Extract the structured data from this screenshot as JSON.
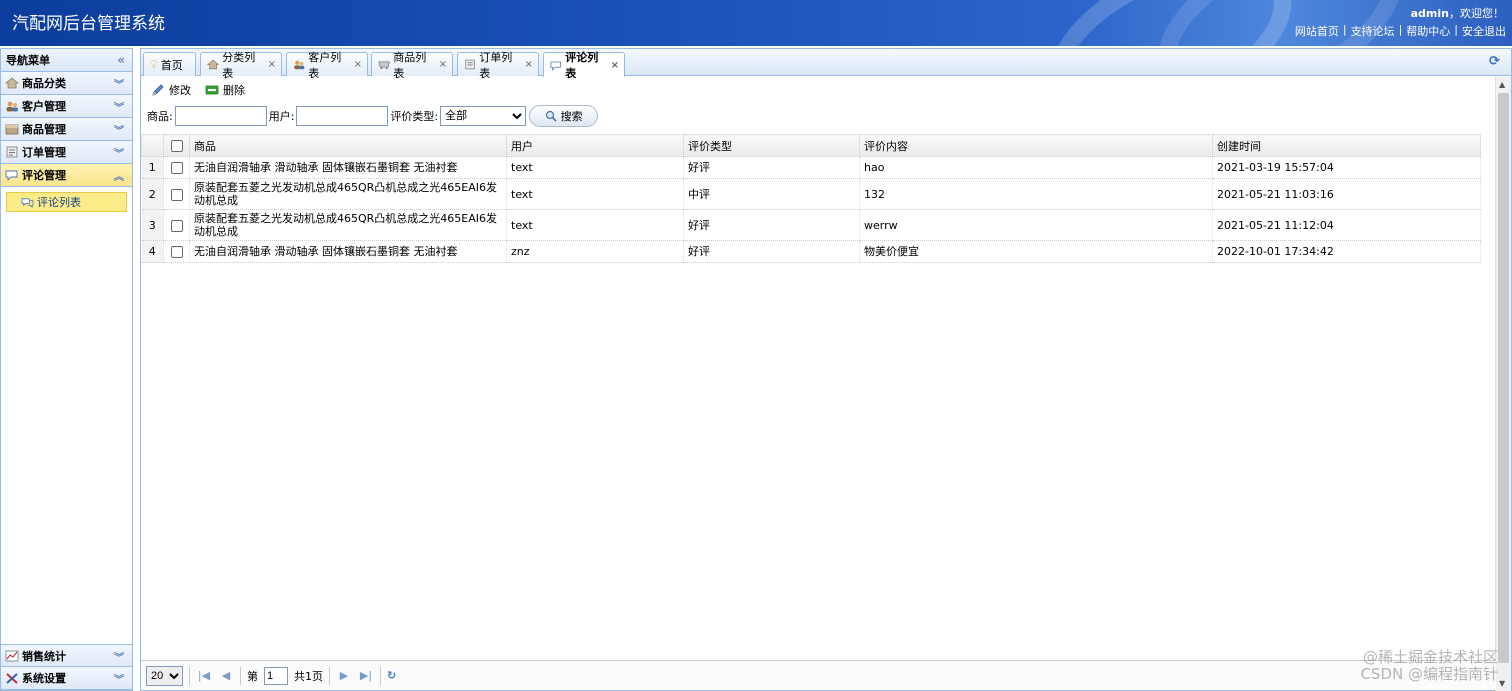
{
  "header": {
    "title": "汽配网后台管理系统",
    "user": "admin",
    "welcome_suffix": "，欢迎您！",
    "links": [
      "网站首页",
      "支持论坛",
      "帮助中心",
      "安全退出"
    ]
  },
  "sidebar": {
    "title": "导航菜单",
    "collapse_glyph": "«",
    "items": [
      {
        "label": "商品分类",
        "icon": "category-icon"
      },
      {
        "label": "客户管理",
        "icon": "customers-icon"
      },
      {
        "label": "商品管理",
        "icon": "goods-icon"
      },
      {
        "label": "订单管理",
        "icon": "orders-icon"
      },
      {
        "label": "评论管理",
        "icon": "comments-icon"
      }
    ],
    "sub_items": [
      {
        "label": "评论列表"
      }
    ],
    "bottom_items": [
      {
        "label": "销售统计",
        "icon": "stats-icon"
      },
      {
        "label": "系统设置",
        "icon": "settings-icon"
      }
    ]
  },
  "tabs": [
    {
      "label": "首页",
      "closable": false
    },
    {
      "label": "分类列表",
      "closable": true
    },
    {
      "label": "客户列表",
      "closable": true
    },
    {
      "label": "商品列表",
      "closable": true
    },
    {
      "label": "订单列表",
      "closable": true
    },
    {
      "label": "评论列表",
      "closable": true,
      "active": true
    }
  ],
  "toolbar": {
    "edit_label": "修改",
    "delete_label": "删除"
  },
  "search": {
    "product_label": "商品:",
    "product_value": "",
    "user_label": "用户:",
    "user_value": "",
    "type_label": "评价类型:",
    "type_selected": "全部",
    "button_label": "搜索"
  },
  "grid": {
    "columns": [
      "商品",
      "用户",
      "评价类型",
      "评价内容",
      "创建时间"
    ],
    "rows": [
      {
        "num": "1",
        "product": "无油自润滑轴承 滑动轴承 固体镶嵌石墨铜套 无油衬套",
        "user": "text",
        "type": "好评",
        "content": "hao",
        "created": "2021-03-19 15:57:04"
      },
      {
        "num": "2",
        "product": "原装配套五菱之光发动机总成465QR凸机总成之光465EAI6发动机总成",
        "user": "text",
        "type": "中评",
        "content": "132",
        "created": "2021-05-21 11:03:16"
      },
      {
        "num": "3",
        "product": "原装配套五菱之光发动机总成465QR凸机总成之光465EAI6发动机总成",
        "user": "text",
        "type": "好评",
        "content": "werrw",
        "created": "2021-05-21 11:12:04"
      },
      {
        "num": "4",
        "product": "无油自润滑轴承 滑动轴承 固体镶嵌石墨铜套 无油衬套",
        "user": "znz",
        "type": "好评",
        "content": "物美价便宜",
        "created": "2022-10-01 17:34:42"
      }
    ]
  },
  "pager": {
    "page_size": "20",
    "page_prefix": "第",
    "page_value": "1",
    "page_total": "共1页"
  },
  "watermark": {
    "line1": "@稀土掘金技术社区",
    "line2": "CSDN @编程指南针"
  },
  "colors": {
    "header_blue": "#1a4fb6",
    "panel_border": "#99bbe8",
    "active_yellow": "#fbec88"
  }
}
